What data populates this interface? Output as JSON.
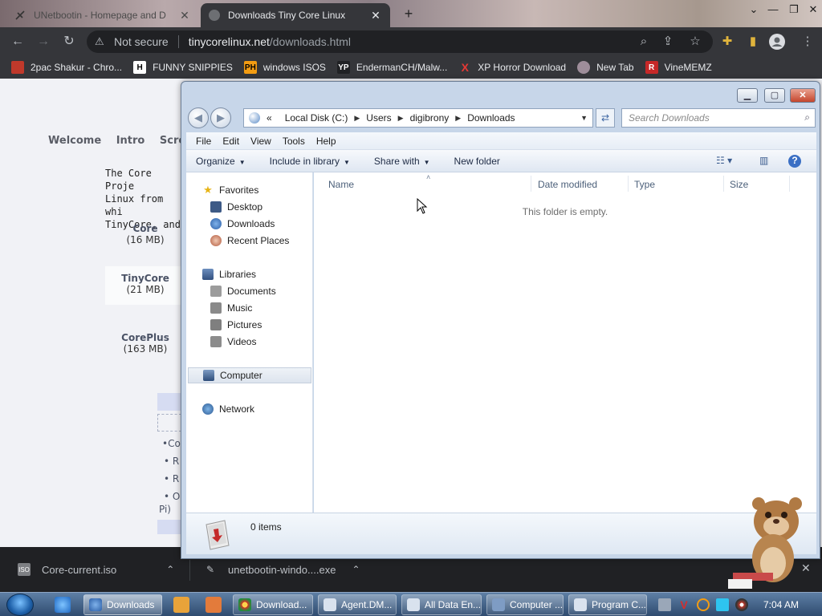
{
  "browser": {
    "tabs": [
      {
        "title": "UNetbootin - Homepage and D",
        "active": false
      },
      {
        "title": "Downloads Tiny Core Linux",
        "active": true
      }
    ],
    "address": {
      "security": "Not secure",
      "host": "tinycorelinux.net",
      "path": "/downloads.html"
    },
    "bookmarks": [
      {
        "label": "2pac Shakur - Chro..."
      },
      {
        "label": "FUNNY SNIPPIES",
        "glyph": "H"
      },
      {
        "label": "windows ISOS",
        "glyph": "PH"
      },
      {
        "label": "EndermanCH/Malw...",
        "glyph": "YP"
      },
      {
        "label": "XP Horror Download",
        "glyph": "X"
      },
      {
        "label": "New Tab"
      },
      {
        "label": "VineMEMZ",
        "glyph": "R"
      }
    ]
  },
  "webpage": {
    "nav": [
      "Welcome",
      "Intro",
      "Scree"
    ],
    "intro_lines": [
      "The Core Proje",
      "Linux from whi",
      "TinyCore, and "
    ],
    "downloads": [
      {
        "name": "Core",
        "size": "(16 MB)"
      },
      {
        "name": "TinyCore",
        "size": "(21 MB)"
      },
      {
        "name": "CorePlus",
        "size": "(163 MB)"
      }
    ],
    "bullets": [
      "•Co",
      "• R",
      "• R",
      "• O",
      "Pi)"
    ]
  },
  "download_bar": {
    "items": [
      {
        "name": "Core-current.iso",
        "icon": "ISO"
      },
      {
        "name": "unetbootin-windo....exe"
      }
    ]
  },
  "explorer": {
    "breadcrumb": [
      "Local Disk (C:)",
      "Users",
      "digibrony",
      "Downloads"
    ],
    "breadcrumb_prefix": "«",
    "search_placeholder": "Search Downloads",
    "menus": [
      "File",
      "Edit",
      "View",
      "Tools",
      "Help"
    ],
    "commands": [
      {
        "label": "Organize",
        "dropdown": true
      },
      {
        "label": "Include in library",
        "dropdown": true
      },
      {
        "label": "Share with",
        "dropdown": true
      },
      {
        "label": "New folder",
        "dropdown": false
      }
    ],
    "nav_pane": {
      "favorites_label": "Favorites",
      "favorites": [
        "Desktop",
        "Downloads",
        "Recent Places"
      ],
      "libraries_label": "Libraries",
      "libraries": [
        "Documents",
        "Music",
        "Pictures",
        "Videos"
      ],
      "computer": "Computer",
      "network": "Network"
    },
    "columns": [
      "Name",
      "Date modified",
      "Type",
      "Size"
    ],
    "empty_message": "This folder is empty.",
    "item_count": "0 items"
  },
  "taskbar": {
    "buttons": [
      {
        "label": "Downloads",
        "active": true
      },
      {
        "label": "Download..."
      },
      {
        "label": "Agent.DM..."
      },
      {
        "label": "All Data En..."
      },
      {
        "label": "Computer ..."
      },
      {
        "label": "Program C..."
      }
    ],
    "clock": "7:04 AM"
  },
  "colors": {
    "chrome_dark": "#35363a",
    "explorer_frame": "#c7d6e9",
    "taskbar": "#2f4b6f"
  }
}
